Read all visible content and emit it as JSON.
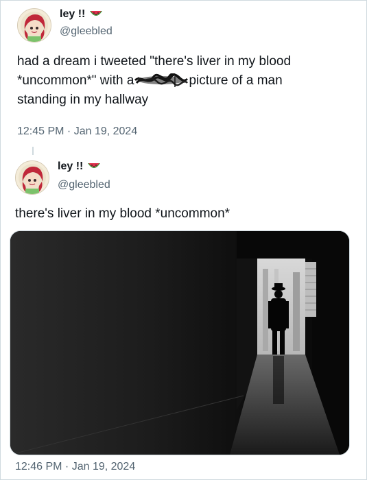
{
  "tweets": [
    {
      "display_name": "ley !!",
      "handle": "@gleebled",
      "text_line1": "had a dream i tweeted \"there's liver in my blood",
      "text_line2_a": "*uncommon*\" with a",
      "text_line2_b": "picture of a man",
      "text_line3": "standing in my hallway",
      "timestamp": "12:45 PM · Jan 19, 2024"
    },
    {
      "display_name": "ley !!",
      "handle": "@gleebled",
      "text": "there's liver in my blood *uncommon*",
      "timestamp": "12:46 PM · Jan 19, 2024"
    }
  ],
  "icons": {
    "badge": "watermelon-icon",
    "avatar": "anime-avatar-icon"
  },
  "colors": {
    "text": "#0f1419",
    "secondary": "#536471",
    "border": "#cfd9de",
    "watermelon_red": "#e0304b",
    "watermelon_green": "#3a9a3a"
  }
}
